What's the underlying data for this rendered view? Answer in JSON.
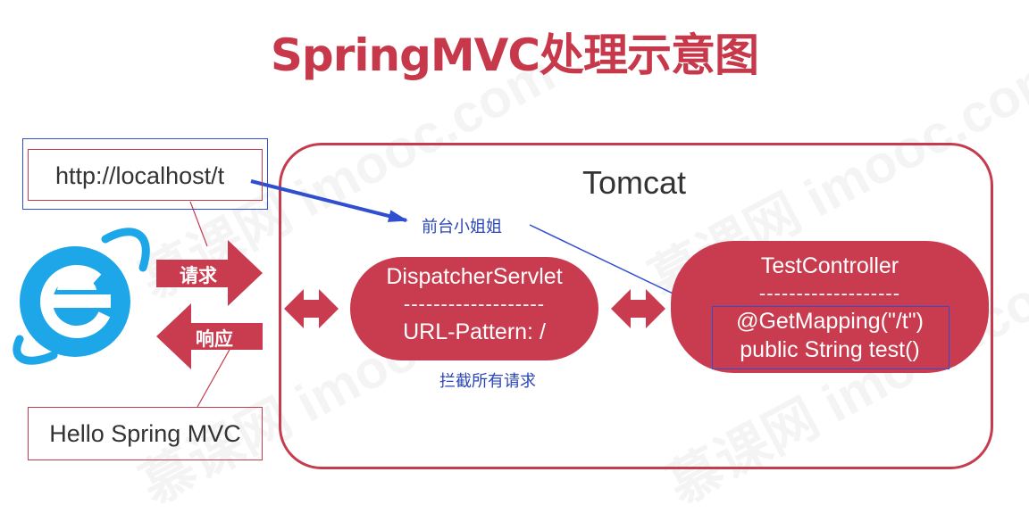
{
  "title": "SpringMVC处理示意图",
  "tomcat": {
    "label": "Tomcat"
  },
  "browser": {
    "url": "http://localhost/t",
    "response_text": "Hello Spring MVC",
    "request_label": "请求",
    "response_label": "响应",
    "icon": "internet-explorer-icon"
  },
  "dispatcher": {
    "name": "DispatcherServlet",
    "divider": "-------------------",
    "pattern": "URL-Pattern: /"
  },
  "controller": {
    "name": "TestController",
    "divider": "-------------------",
    "mapping": "@GetMapping(\"/t\")",
    "method": "public String test()"
  },
  "annotations": {
    "reception": "前台小姐姐",
    "intercept": "拦截所有请求"
  },
  "colors": {
    "accent": "#c93b4e",
    "annotation_blue": "#2f4fd0",
    "ie_blue": "#1ea7e8",
    "text": "#333333"
  },
  "watermark": "慕课网 imooc.com"
}
